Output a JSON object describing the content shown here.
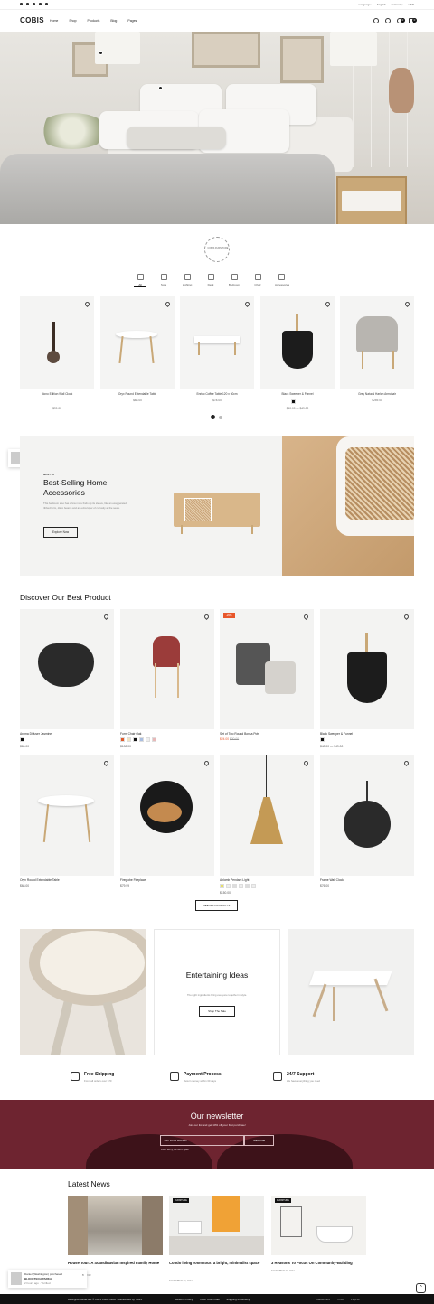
{
  "topbar": {
    "language_label": "Language:",
    "language_value": "English",
    "currency_label": "Currency:",
    "currency_value": "USD"
  },
  "header": {
    "logo": "COBIS",
    "nav": [
      "Home",
      "Shop",
      "Products",
      "Blog",
      "Pages"
    ],
    "wishlist_count": "0",
    "cart_count": "0"
  },
  "stamp_text": "COBIS FURNITURE",
  "categories": [
    "All",
    "Sofa",
    "Lighting",
    "Desk",
    "Bedroom",
    "Chair",
    "Accessories"
  ],
  "products": [
    {
      "name": "Mono Edition Wall Clock",
      "price": "$99.00"
    },
    {
      "name": "Oryx Round Extendable Table",
      "price": "$68.00"
    },
    {
      "name": "Enrico Coffee Table 120 x 60cm",
      "price": "$78.00"
    },
    {
      "name": "Black Sweeper & Funnel",
      "price": "$40.00 — $49.00"
    },
    {
      "name": "Grey Natural Harlan Armchair",
      "price": "$249.00"
    }
  ],
  "popup": {
    "who": "Daniel (Washington) purchased",
    "product": "BLOCKTECH PARKA",
    "meta": "2 hours ago",
    "verified": "Verified"
  },
  "banner": {
    "eyebrow": "MUST BY",
    "title": "Best-Selling Home Accessories",
    "desc": "This bedroom also has a few more finds up its sleeve, like an exaggerated ribbed form, disco beams and an extra layer of curiosity at the seats.",
    "button": "Explore Now"
  },
  "best": {
    "title": "Discover Our Best Product",
    "items": [
      {
        "name": "Aroma Diffuser Jasmine",
        "price": "$86.00",
        "sale": "",
        "old": ""
      },
      {
        "name": "Form Chair Oak",
        "price": "$108.00",
        "sale": "",
        "old": ""
      },
      {
        "name": "Set of Two Round Bonsa Pots",
        "price": "$24.00",
        "sale": "-20%",
        "old": "$30.00"
      },
      {
        "name": "Black Sweeper & Funnel",
        "price": "$40.00 — $49.00",
        "sale": "",
        "old": ""
      },
      {
        "name": "Oryx Round Extendable Table",
        "price": "$68.00",
        "sale": "",
        "old": ""
      },
      {
        "name": "Fireglobe Fireplace",
        "price": "$79.99",
        "sale": "",
        "old": ""
      },
      {
        "name": "Aplomb Pendant Light",
        "price": "$150.00",
        "sale": "",
        "old": ""
      },
      {
        "name": "Frame Wall Clock",
        "price": "$76.00",
        "sale": "",
        "old": ""
      }
    ],
    "see_all": "SEE ALL PRODUCTS"
  },
  "ent": {
    "title": "Entertaining Ideas",
    "desc": "The right ingredients bring everyone together in style.",
    "button": "Shop The Sale"
  },
  "features": [
    {
      "title": "Free Shipping",
      "desc": "From all orders over $70"
    },
    {
      "title": "Payment Process",
      "desc": "Return money within 30 days"
    },
    {
      "title": "24/7 Support",
      "desc": "We have everything you need"
    }
  ],
  "newsletter": {
    "title": "Our newsletter",
    "sub": "Join our list and get 10% off your first purchase!",
    "placeholder": "Your email address",
    "button": "Subscribe",
    "note": "*Don't worry, we don't spam"
  },
  "news": {
    "title": "Latest News",
    "items": [
      {
        "tag": "FURNITURE",
        "title": "House Tour: A Scandinavian Inspired Family Home",
        "date": "NOVEMBER 23, 2022"
      },
      {
        "tag": "FURNITURE",
        "title": "Condo living room tour: a bright, minimalist space",
        "date": "NOVEMBER 23, 2022"
      },
      {
        "tag": "FURNITURE",
        "title": "3 Reasons To Focus On Community-Building",
        "date": "NOVEMBER 23, 2022"
      }
    ]
  },
  "footer": {
    "copy": "All Rights Reserved © 2023 Cobis store - Developed by Tlev4",
    "links": [
      "Returns Policy",
      "Track Your Order",
      "Shipping & Delivery"
    ],
    "pay": [
      "Mastercard",
      "VISA",
      "PayPal"
    ]
  },
  "colors": {
    "newsletter_bg": "#6e2430",
    "sale_badge": "#e8562a",
    "footer_bg": "#111111"
  }
}
